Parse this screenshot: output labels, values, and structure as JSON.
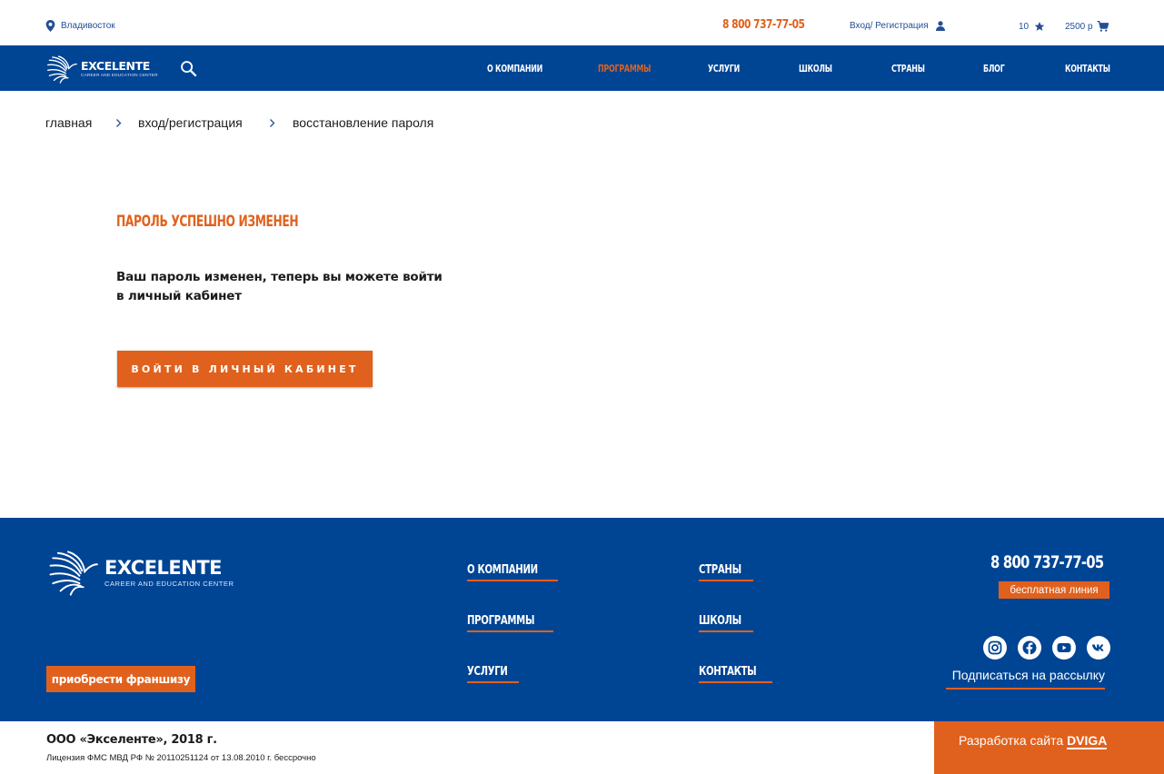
{
  "topbar": {
    "city": "Владивосток",
    "phone": "8 800 737-77-05",
    "login": "Вход/ Регистрация",
    "favorites_count": "10",
    "cart_total": "2500 р"
  },
  "nav": {
    "brand": "EXCELENTE",
    "brand_sub": "CAREER AND EDUCATION CENTER",
    "items": [
      {
        "label": "О компании",
        "active": false
      },
      {
        "label": "Программы",
        "active": true
      },
      {
        "label": "Услуги",
        "active": false
      },
      {
        "label": "Школы",
        "active": false
      },
      {
        "label": "Страны",
        "active": false
      },
      {
        "label": "Блог",
        "active": false
      },
      {
        "label": "Контакты",
        "active": false
      }
    ]
  },
  "breadcrumbs": [
    "главная",
    "вход/регистрация",
    "восстановление пароля"
  ],
  "main": {
    "heading": "Пароль успешно изменен",
    "message": "Ваш пароль изменен, теперь вы можете войти в личный кабинет",
    "button": "Войти в личный кабинет"
  },
  "footer": {
    "brand": "EXCELENTE",
    "brand_sub": "CAREER AND EDUCATION CENTER",
    "franchise": "приобрести франшизу",
    "links_col1": [
      "О компании",
      "Программы",
      "Услуги"
    ],
    "links_col2": [
      "Страны",
      "Школы",
      "Контакты"
    ],
    "phone": "8 800 737-77-05",
    "free_line": "бесплатная линия",
    "socials": [
      "instagram-icon",
      "facebook-icon",
      "youtube-icon",
      "vk-icon"
    ],
    "subscribe": "Подписаться на рассылку"
  },
  "bottom": {
    "copyright": "ООО «Экселенте», 2018 г.",
    "license": "Лицензия ФМС МВД РФ № 20110251124 от 13.08.2010 г. бессрочно",
    "dev_prefix": "Разработка сайта",
    "dev_brand": "DVIGA"
  },
  "colors": {
    "brand_blue": "#004494",
    "accent_orange": "#e0611d",
    "link_blue": "#234f96"
  }
}
